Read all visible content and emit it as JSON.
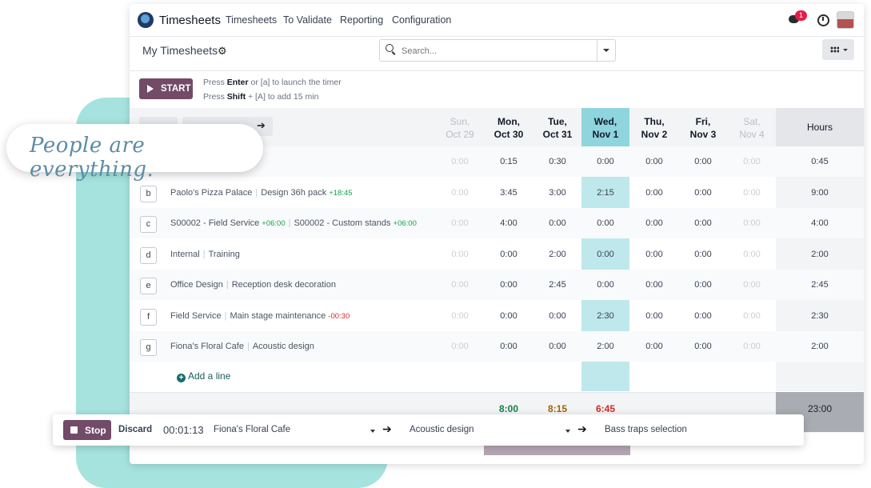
{
  "navbar": {
    "app_name": "Timesheets",
    "menu": [
      "Timesheets",
      "To Validate",
      "Reporting",
      "Configuration"
    ],
    "chat_badge": "1"
  },
  "control": {
    "title": "My Timesheets",
    "search_placeholder": "Search..."
  },
  "timer": {
    "start_label": "START",
    "hint1_pre": "Press ",
    "hint1_key": "Enter",
    "hint1_post": " or [a] to launch the timer",
    "hint2_pre": "Press ",
    "hint2_key": "Shift",
    "hint2_post": " + [A] to add 15 min"
  },
  "grid": {
    "days": [
      {
        "d": "Sun,",
        "n": "Oct 29",
        "type": "weekend"
      },
      {
        "d": "Mon,",
        "n": "Oct 30",
        "type": "normal"
      },
      {
        "d": "Tue,",
        "n": "Oct 31",
        "type": "normal"
      },
      {
        "d": "Wed,",
        "n": "Nov 1",
        "type": "today"
      },
      {
        "d": "Thu,",
        "n": "Nov 2",
        "type": "normal"
      },
      {
        "d": "Fri,",
        "n": "Nov 3",
        "type": "normal"
      },
      {
        "d": "Sat,",
        "n": "Nov 4",
        "type": "weekend"
      }
    ],
    "hours_label": "Hours",
    "rows": [
      {
        "key": "",
        "project": "",
        "task": "",
        "delta": "",
        "delta_type": "",
        "cells": [
          "0:00",
          "0:15",
          "0:30",
          "0:00",
          "0:00",
          "0:00",
          "0:00"
        ],
        "total": "0:45"
      },
      {
        "key": "b",
        "project": "Paolo's Pizza Palace",
        "task": "Design 36h pack",
        "delta": "+18:45",
        "delta_type": "plus",
        "cells": [
          "0:00",
          "3:45",
          "3:00",
          "2:15",
          "0:00",
          "0:00",
          "0:00"
        ],
        "total": "9:00"
      },
      {
        "key": "c",
        "project": "S00002 - Field Service",
        "project_delta": "+06:00",
        "task": "S00002 - Custom stands",
        "delta": "+06:00",
        "delta_type": "plus",
        "cells": [
          "0:00",
          "4:00",
          "0:00",
          "0:00",
          "0:00",
          "0:00",
          "0:00"
        ],
        "total": "4:00"
      },
      {
        "key": "d",
        "project": "Internal",
        "task": "Training",
        "delta": "",
        "delta_type": "",
        "cells": [
          "0:00",
          "0:00",
          "2:00",
          "0:00",
          "0:00",
          "0:00",
          "0:00"
        ],
        "total": "2:00"
      },
      {
        "key": "e",
        "project": "Office Design",
        "task": "Reception desk decoration",
        "delta": "",
        "delta_type": "",
        "cells": [
          "0:00",
          "0:00",
          "2:45",
          "0:00",
          "0:00",
          "0:00",
          "0:00"
        ],
        "total": "2:45"
      },
      {
        "key": "f",
        "project": "Field Service",
        "task": "Main stage maintenance",
        "delta": "-00:30",
        "delta_type": "minus",
        "cells": [
          "0:00",
          "0:00",
          "0:00",
          "2:30",
          "0:00",
          "0:00",
          "0:00"
        ],
        "total": "2:30"
      },
      {
        "key": "g",
        "project": "Fiona's Floral Cafe",
        "task": "Acoustic design",
        "delta": "",
        "delta_type": "",
        "cells": [
          "0:00",
          "0:00",
          "0:00",
          "2:00",
          "0:00",
          "0:00",
          "0:00"
        ],
        "total": "2:00"
      }
    ],
    "add_line": "Add a line",
    "footer_totals": [
      "8:00",
      "8:15",
      "6:45"
    ],
    "footer_colors": [
      "#15803d",
      "#a16207",
      "#dc2626"
    ],
    "grand_total": "23:00"
  },
  "tagline": "People are everything.",
  "timer_bar": {
    "stop": "Stop",
    "discard": "Discard",
    "elapsed": "00:01:13",
    "project": "Fiona's Floral Cafe",
    "task": "Acoustic design",
    "description": "Bass traps selection"
  },
  "colors": {
    "accent": "#714B67",
    "today": "#8ed5de",
    "teal_bg": "#a6e3df"
  }
}
